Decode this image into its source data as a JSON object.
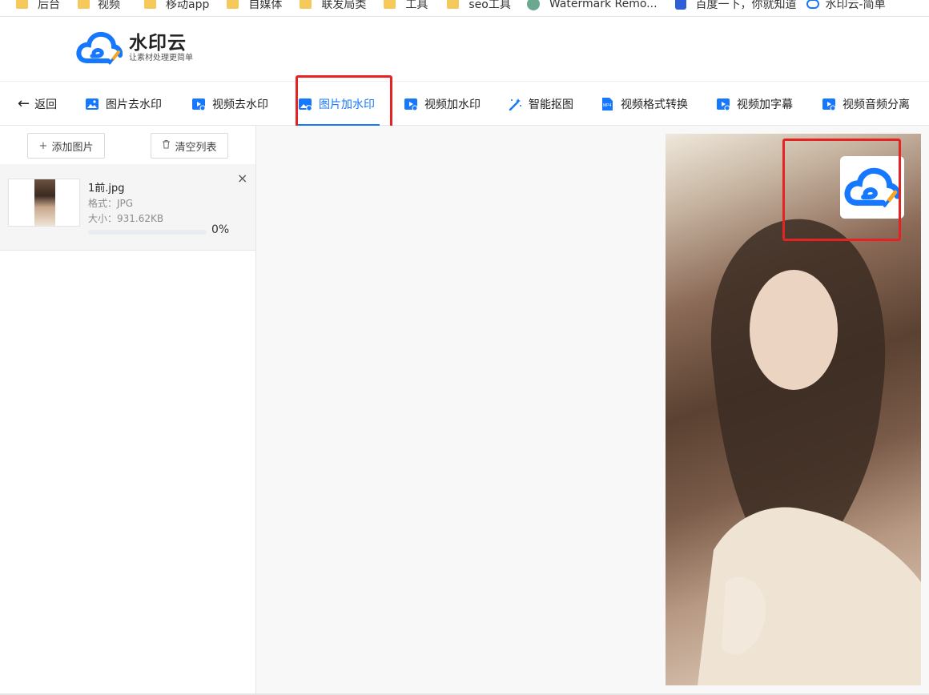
{
  "bookmarks": [
    {
      "label": "后台",
      "icon": "folder-icon"
    },
    {
      "label": "视频",
      "icon": "folder-icon"
    },
    {
      "label": "移动app",
      "icon": "folder-icon"
    },
    {
      "label": "自媒体",
      "icon": "folder-icon"
    },
    {
      "label": "联发局类",
      "icon": "folder-icon"
    },
    {
      "label": "工具",
      "icon": "folder-icon"
    },
    {
      "label": "seo工具",
      "icon": "folder-icon"
    },
    {
      "label": "Watermark Remo...",
      "icon": "site-icon"
    },
    {
      "label": "百度一下，你就知道",
      "icon": "baidu-icon"
    },
    {
      "label": "水印云-简单",
      "icon": "site-icon"
    }
  ],
  "brand": {
    "name": "水印云",
    "slogan": "让素材处理更简单",
    "color": "#1677ff",
    "accent": "#f5a623"
  },
  "toolbar": {
    "back": "返回",
    "items": [
      {
        "label": "图片去水印",
        "icon": "image-remove-watermark-icon"
      },
      {
        "label": "视频去水印",
        "icon": "video-remove-watermark-icon"
      },
      {
        "label": "图片加水印",
        "icon": "image-add-watermark-icon",
        "active": true
      },
      {
        "label": "视频加水印",
        "icon": "video-add-watermark-icon"
      },
      {
        "label": "智能抠图",
        "icon": "magic-wand-icon"
      },
      {
        "label": "视频格式转换",
        "icon": "mp4-file-icon"
      },
      {
        "label": "视频加字幕",
        "icon": "video-subtitle-icon"
      },
      {
        "label": "视频音频分离",
        "icon": "video-audio-split-icon"
      }
    ]
  },
  "sidebar": {
    "add_label": "添加图片",
    "clear_label": "清空列表",
    "files": [
      {
        "name": "1前.jpg",
        "format": "格式：JPG",
        "size": "大小：931.62KB",
        "progress": 0,
        "progress_label": "0%"
      }
    ]
  },
  "highlight_color": "#e62323"
}
